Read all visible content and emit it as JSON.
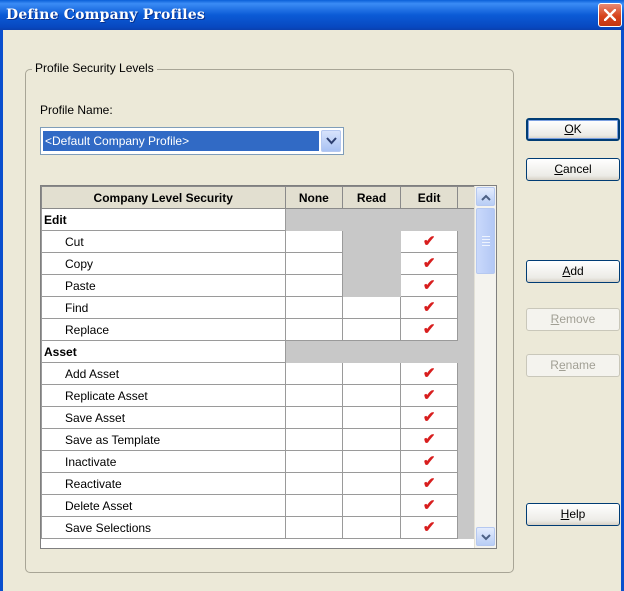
{
  "window": {
    "title": "Define Company Profiles"
  },
  "group": {
    "legend": "Profile Security Levels",
    "profile_label": "Profile Name:",
    "profile_value": "<Default Company Profile>"
  },
  "grid": {
    "columns": [
      "Company Level Security",
      "None",
      "Read",
      "Edit"
    ],
    "sections": [
      {
        "name": "Edit",
        "items": [
          "Cut",
          "Copy",
          "Paste",
          "Find",
          "Replace"
        ]
      },
      {
        "name": "Asset",
        "items": [
          "Add Asset",
          "Replicate Asset",
          "Save Asset",
          "Save as Template",
          "Inactivate",
          "Reactivate",
          "Delete Asset",
          "Save Selections"
        ]
      }
    ],
    "check_glyph": "✔"
  },
  "buttons": {
    "ok": {
      "mn": "O",
      "rest": "K"
    },
    "cancel": {
      "mn": "C",
      "rest": "ancel"
    },
    "add": {
      "mn": "A",
      "rest": "dd"
    },
    "remove": {
      "mn": "R",
      "rest": "emove"
    },
    "rename": {
      "pre": "R",
      "mn": "e",
      "rest": "name"
    },
    "help": {
      "mn": "H",
      "rest": "elp"
    }
  },
  "colors": {
    "accent": "#0a5fd8",
    "selection": "#316ac5",
    "check": "#d81e1e"
  }
}
